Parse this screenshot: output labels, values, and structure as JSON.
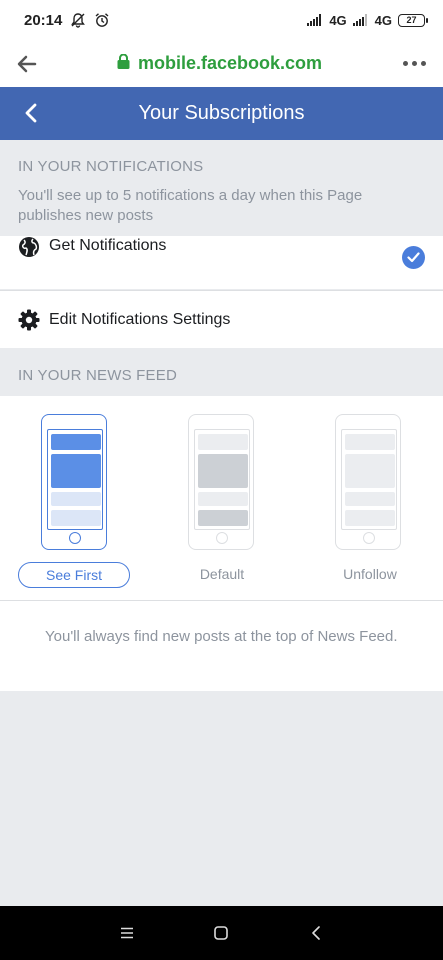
{
  "status_bar": {
    "time": "20:14",
    "network1": "4G",
    "network2": "4G",
    "battery": "27"
  },
  "url_bar": {
    "url": "mobile.facebook.com"
  },
  "header": {
    "title": "Your Subscriptions"
  },
  "notifications": {
    "section_label": "IN YOUR NOTIFICATIONS",
    "description": "You'll see up to 5 notifications a day when this Page publishes new posts",
    "get_notifications_label": "Get Notifications",
    "edit_settings_label": "Edit Notifications Settings"
  },
  "news_feed": {
    "section_label": "IN YOUR NEWS FEED",
    "options": [
      {
        "label": "See First",
        "selected": true
      },
      {
        "label": "Default",
        "selected": false
      },
      {
        "label": "Unfollow",
        "selected": false
      }
    ],
    "description": "You'll always find new posts at the top of News Feed."
  },
  "colors": {
    "brand": "#4267b2",
    "accent": "#4a7ddb",
    "url_green": "#2e9e3e"
  }
}
